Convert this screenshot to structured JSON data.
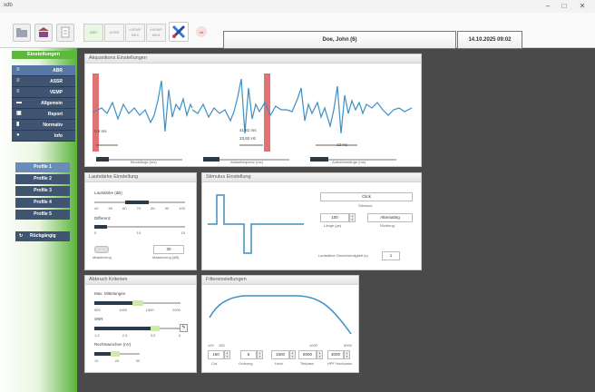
{
  "window": {
    "title": "xdb",
    "min": "–",
    "max": "□",
    "close": "✕"
  },
  "toolbar": {
    "tab_abr": "ABR",
    "tab_assr": "ASSR",
    "tab_cvemp": "cVEMP BKS",
    "tab_ovemp": "oVEMP MKA",
    "patient": "Doe, John (6)",
    "date": "14.10.2025 09:02"
  },
  "sidebar": {
    "header": "Einstellungen",
    "items": [
      {
        "label": "ABR",
        "icon": "≡"
      },
      {
        "label": "ASSR",
        "icon": "≡"
      },
      {
        "label": "VEMP",
        "icon": "≡"
      },
      {
        "label": "Allgemein",
        "icon": "▬"
      },
      {
        "label": "Report",
        "icon": "▣"
      },
      {
        "label": "Normativ",
        "icon": "▮"
      },
      {
        "label": "Info",
        "icon": "●"
      }
    ],
    "profiles": [
      "Profile 1",
      "Profile 2",
      "Profile 3",
      "Profile 4",
      "Profile 5"
    ],
    "back": "Rückgängig",
    "back_icon": "↻"
  },
  "akq": {
    "title": "Akquisitions Einstellungen",
    "m1_value": "0,6 ms",
    "m1_label": "Blocklänge (ms)",
    "m2_value1": "41,81 ms",
    "m2_value2": "23,92 Hz",
    "m2_label": "Abtastfrequenz (ms)",
    "m3_value": "12 ms",
    "m3_label": "Aufnahmelänge (ms)"
  },
  "lautstaerke": {
    "title": "Lautstärke Einstellung",
    "label1": "Lautstärke (dB)",
    "ticks1": [
      "40",
      "50",
      "60",
      "70",
      "80",
      "90",
      "100"
    ],
    "label2": "Differenz",
    "ticks2": [
      "5",
      "10",
      "15"
    ],
    "toggle_label": "Maskierung",
    "masking_value": "30",
    "masking_label": "Maskierung (dB)"
  },
  "stimulus": {
    "title": "Stimulus Einstellung",
    "stimulus_value": "Click",
    "stimulus_label": "Stimulus",
    "length_value": "100",
    "length_label": "Länge (µs)",
    "polarity_value": "Alternating",
    "polarity_label": "Richtung",
    "rate_label": "Lautstärke Geschwindigkeit (s)",
    "rate_value": "1"
  },
  "abbruch": {
    "title": "Abbruch Kriterien",
    "label1": "Max. Mittelungen",
    "ticks1": [
      "500",
      "1000",
      "1500",
      "2000"
    ],
    "label2": "SNR",
    "ticks2": [
      "1,5",
      "2,5",
      "3,5",
      "4"
    ],
    "label3": "Rechtsweichen (nV)",
    "ticks3": [
      "10",
      "20",
      "30"
    ]
  },
  "filter": {
    "title": "Filtereinstellungen",
    "axis_left": [
      "100",
      "150"
    ],
    "axis_mid": "1000",
    "axis_right": "5000",
    "fields": [
      {
        "value": "150",
        "label": "Cut"
      },
      {
        "value": "6",
        "label": "Ordnung"
      },
      {
        "value": "1500",
        "label": "Hoch"
      },
      {
        "value": "6000",
        "label": "Tiefpass"
      },
      {
        "value": "3000",
        "label": "HPF Hochpass"
      }
    ]
  },
  "colors": {
    "accent_green": "#5cb83a",
    "nav_dark": "#3f5470",
    "nav_selected": "#5777a4",
    "wave_blue": "#3d8fc4",
    "marker_red": "#d95b5b"
  }
}
